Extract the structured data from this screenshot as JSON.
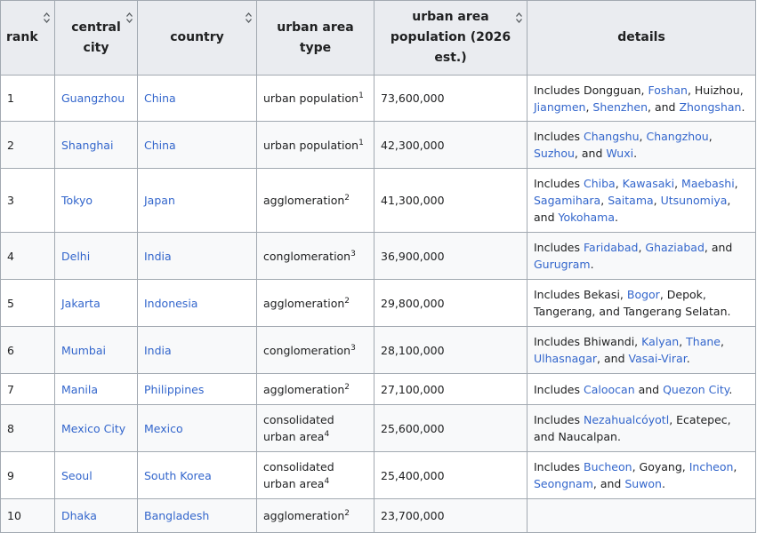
{
  "headers": {
    "rank": "rank",
    "city": "central city",
    "country": "country",
    "type": "urban area type",
    "population": "urban area population (2026 est.)",
    "details": "details"
  },
  "rows": [
    {
      "rank": "1",
      "city": "Guangzhou",
      "country": "China",
      "type": "urban population",
      "sup": "1",
      "population": "73,600,000",
      "details": [
        {
          "t": "Includes Dongguan, "
        },
        {
          "t": "Foshan",
          "l": 1
        },
        {
          "t": ", Huizhou, "
        },
        {
          "t": "Jiangmen",
          "l": 1
        },
        {
          "t": ", "
        },
        {
          "t": "Shenzhen",
          "l": 1
        },
        {
          "t": ", and "
        },
        {
          "t": "Zhongshan",
          "l": 1
        },
        {
          "t": "."
        }
      ]
    },
    {
      "rank": "2",
      "city": "Shanghai",
      "country": "China",
      "type": "urban population",
      "sup": "1",
      "population": "42,300,000",
      "details": [
        {
          "t": "Includes "
        },
        {
          "t": "Changshu",
          "l": 1
        },
        {
          "t": ", "
        },
        {
          "t": "Changzhou",
          "l": 1
        },
        {
          "t": ", "
        },
        {
          "t": "Suzhou",
          "l": 1
        },
        {
          "t": ", and "
        },
        {
          "t": "Wuxi",
          "l": 1
        },
        {
          "t": "."
        }
      ]
    },
    {
      "rank": "3",
      "city": "Tokyo",
      "country": "Japan",
      "type": "agglomeration",
      "sup": "2",
      "population": "41,300,000",
      "details": [
        {
          "t": "Includes "
        },
        {
          "t": "Chiba",
          "l": 1
        },
        {
          "t": ", "
        },
        {
          "t": "Kawasaki",
          "l": 1
        },
        {
          "t": ", "
        },
        {
          "t": "Maebashi",
          "l": 1
        },
        {
          "t": ", "
        },
        {
          "t": "Sagamihara",
          "l": 1
        },
        {
          "t": ", "
        },
        {
          "t": "Saitama",
          "l": 1
        },
        {
          "t": ", "
        },
        {
          "t": "Utsunomiya",
          "l": 1
        },
        {
          "t": ", and "
        },
        {
          "t": "Yokohama",
          "l": 1
        },
        {
          "t": "."
        }
      ]
    },
    {
      "rank": "4",
      "city": "Delhi",
      "country": "India",
      "type": "conglomeration",
      "sup": "3",
      "population": "36,900,000",
      "details": [
        {
          "t": "Includes "
        },
        {
          "t": "Faridabad",
          "l": 1
        },
        {
          "t": ", "
        },
        {
          "t": "Ghaziabad",
          "l": 1
        },
        {
          "t": ", and "
        },
        {
          "t": "Gurugram",
          "l": 1
        },
        {
          "t": "."
        }
      ]
    },
    {
      "rank": "5",
      "city": "Jakarta",
      "country": "Indonesia",
      "type": "agglomeration",
      "sup": "2",
      "population": "29,800,000",
      "details": [
        {
          "t": "Includes Bekasi, "
        },
        {
          "t": "Bogor",
          "l": 1
        },
        {
          "t": ", Depok, Tangerang, and Tangerang Selatan."
        }
      ]
    },
    {
      "rank": "6",
      "city": "Mumbai",
      "country": "India",
      "type": "conglomeration",
      "sup": "3",
      "population": "28,100,000",
      "details": [
        {
          "t": "Includes Bhiwandi, "
        },
        {
          "t": "Kalyan",
          "l": 1
        },
        {
          "t": ", "
        },
        {
          "t": "Thane",
          "l": 1
        },
        {
          "t": ", "
        },
        {
          "t": "Ulhasnagar",
          "l": 1
        },
        {
          "t": ", and "
        },
        {
          "t": "Vasai-Virar",
          "l": 1
        },
        {
          "t": "."
        }
      ]
    },
    {
      "rank": "7",
      "city": "Manila",
      "country": "Philippines",
      "type": "agglomeration",
      "sup": "2",
      "population": "27,100,000",
      "details": [
        {
          "t": "Includes "
        },
        {
          "t": "Caloocan",
          "l": 1
        },
        {
          "t": " and "
        },
        {
          "t": "Quezon City",
          "l": 1
        },
        {
          "t": "."
        }
      ]
    },
    {
      "rank": "8",
      "city": "Mexico City",
      "country": "Mexico",
      "type": "consolidated urban area",
      "sup": "4",
      "population": "25,600,000",
      "details": [
        {
          "t": "Includes "
        },
        {
          "t": "Nezahualcóyotl",
          "l": 1
        },
        {
          "t": ", Ecatepec, and Naucalpan."
        }
      ]
    },
    {
      "rank": "9",
      "city": "Seoul",
      "country": "South Korea",
      "type": "consolidated urban area",
      "sup": "4",
      "population": "25,400,000",
      "details": [
        {
          "t": "Includes "
        },
        {
          "t": "Bucheon",
          "l": 1
        },
        {
          "t": ", Goyang, "
        },
        {
          "t": "Incheon",
          "l": 1
        },
        {
          "t": ", "
        },
        {
          "t": "Seongnam",
          "l": 1
        },
        {
          "t": ", and "
        },
        {
          "t": "Suwon",
          "l": 1
        },
        {
          "t": "."
        }
      ]
    },
    {
      "rank": "10",
      "city": "Dhaka",
      "country": "Bangladesh",
      "type": "agglomeration",
      "sup": "2",
      "population": "23,700,000",
      "details": []
    }
  ],
  "colors": {
    "link": "#3366cc",
    "header_bg": "#eaecf0",
    "stripe_bg": "#f8f9fa",
    "border": "#a2a9b1"
  }
}
